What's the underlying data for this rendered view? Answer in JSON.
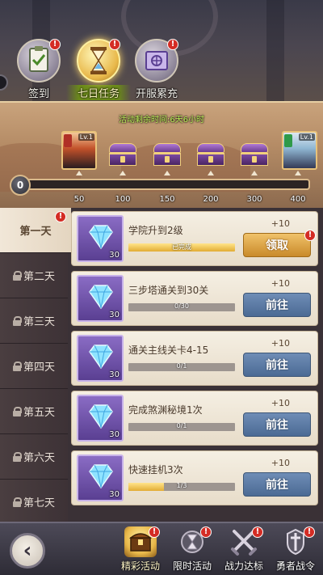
{
  "top_tabs": [
    {
      "label": "签到",
      "icon": "checklist-icon",
      "active": false,
      "badge": "!"
    },
    {
      "label": "七日任务",
      "icon": "hourglass-icon",
      "active": true,
      "badge": "!"
    },
    {
      "label": "开服累充",
      "icon": "gift-book-icon",
      "active": false,
      "badge": "!"
    }
  ],
  "progress": {
    "timer_text": "活动剩余时间:6天6小时",
    "current_points": "0",
    "fill_fraction": 0.0,
    "portrait_left_level": "Lv.1",
    "portrait_right_level": "Lv.1",
    "milestones": [
      "50",
      "100",
      "150",
      "200",
      "300",
      "400"
    ]
  },
  "days": [
    {
      "label": "第一天",
      "locked": false,
      "active": true,
      "badge": "!"
    },
    {
      "label": "第二天",
      "locked": true,
      "active": false
    },
    {
      "label": "第三天",
      "locked": false,
      "active": false
    },
    {
      "label": "第四天",
      "locked": false,
      "active": false
    },
    {
      "label": "第五天",
      "locked": false,
      "active": false
    },
    {
      "label": "第六天",
      "locked": false,
      "active": false
    },
    {
      "label": "第七天",
      "locked": true,
      "active": false
    }
  ],
  "tasks": [
    {
      "title": "学院升到2级",
      "progress_text": "已完成",
      "progress_fraction": 1.0,
      "reward": "+10",
      "gem_count": "30",
      "button": "领取",
      "button_type": "claim",
      "badge": "!"
    },
    {
      "title": "三步塔通关到30关",
      "progress_text": "0/30",
      "progress_fraction": 0.0,
      "reward": "+10",
      "gem_count": "30",
      "button": "前往",
      "button_type": "go"
    },
    {
      "title": "通关主线关卡4-15",
      "progress_text": "0/1",
      "progress_fraction": 0.0,
      "reward": "+10",
      "gem_count": "30",
      "button": "前往",
      "button_type": "go"
    },
    {
      "title": "完成煞渊秘境1次",
      "progress_text": "0/1",
      "progress_fraction": 0.0,
      "reward": "+10",
      "gem_count": "30",
      "button": "前往",
      "button_type": "go"
    },
    {
      "title": "快速挂机3次",
      "progress_text": "1/3",
      "progress_fraction": 0.333,
      "reward": "+10",
      "gem_count": "30",
      "button": "前往",
      "button_type": "go"
    }
  ],
  "bottom_tabs": [
    {
      "label": "精彩活动",
      "icon": "treasure-chest-icon",
      "active": true,
      "badge": "!"
    },
    {
      "label": "限时活动",
      "icon": "hourglass-icon",
      "active": false,
      "badge": "!"
    },
    {
      "label": "战力达标",
      "icon": "crossed-swords-icon",
      "active": false,
      "badge": "!"
    },
    {
      "label": "勇者战令",
      "icon": "sword-shield-icon",
      "active": false,
      "badge": "!"
    }
  ],
  "colors": {
    "accent_gold": "#e9b84a",
    "go_button": "#5b7aa4",
    "timer_green": "#bff05a",
    "badge_red": "#d42c24"
  }
}
